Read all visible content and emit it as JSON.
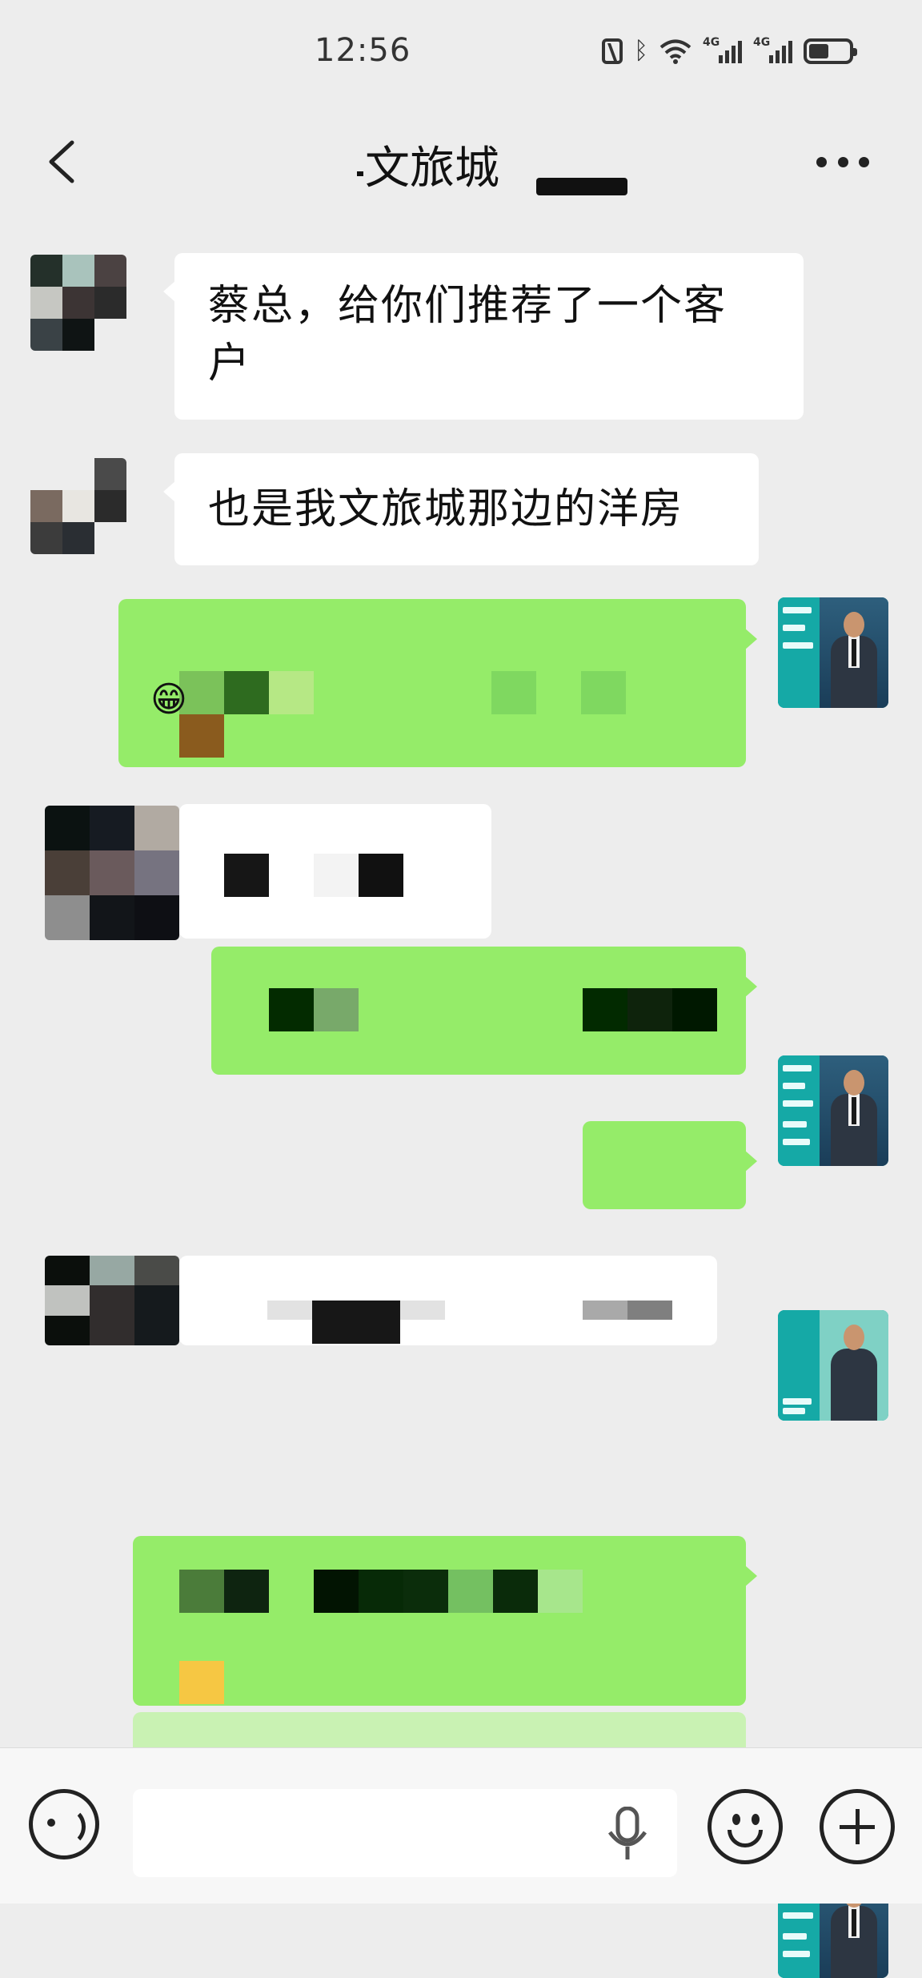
{
  "status_bar": {
    "time": "12:56",
    "network_labels": [
      "4G",
      "4G"
    ],
    "icons": [
      "nfc-icon",
      "bluetooth-icon",
      "wifi-icon",
      "signal-icon",
      "signal-icon",
      "battery-icon"
    ]
  },
  "header": {
    "title": "文旅城",
    "back_icon": "chevron-left-icon",
    "more_icon": "more-dots-icon"
  },
  "messages": [
    {
      "side": "left",
      "text": "蔡总，给你们推荐了一个客户",
      "line1": "蔡总，给你们推荐了一个客",
      "line2": "户"
    },
    {
      "side": "left",
      "text": "也是我文旅城那边的洋房"
    },
    {
      "side": "right",
      "text": "",
      "redacted": true,
      "emoji": "😁"
    },
    {
      "side": "left",
      "text": "",
      "redacted": true
    },
    {
      "side": "right",
      "text": "",
      "redacted": true
    },
    {
      "side": "right",
      "text": "",
      "redacted": true
    },
    {
      "side": "left",
      "text": "",
      "redacted": true
    },
    {
      "side": "right",
      "text": "",
      "redacted": true
    }
  ],
  "input_bar": {
    "placeholder": "",
    "icons": [
      "voice-icon",
      "mic-icon",
      "emoji-icon",
      "plus-icon"
    ]
  },
  "colors": {
    "background": "#ededed",
    "sent_bubble": "#95ec69",
    "received_bubble": "#ffffff"
  }
}
